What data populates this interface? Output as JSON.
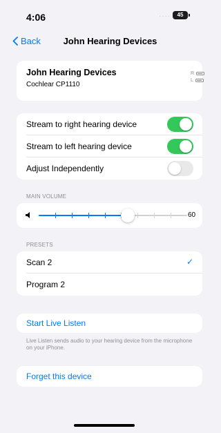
{
  "status_bar": {
    "time": "4:06",
    "signal": "····",
    "battery": "45"
  },
  "nav": {
    "back_label": "Back",
    "title": "John Hearing Devices"
  },
  "device": {
    "name": "John Hearing Devices",
    "model": "Cochlear CP1110",
    "right_label": "R",
    "left_label": "L"
  },
  "toggles": [
    {
      "label": "Stream to right hearing device",
      "on": true
    },
    {
      "label": "Stream to left hearing device",
      "on": true
    },
    {
      "label": "Adjust Independently",
      "on": false
    }
  ],
  "volume": {
    "header": "MAIN VOLUME",
    "value": "60",
    "fraction": 0.6
  },
  "presets": {
    "header": "PRESETS",
    "items": [
      {
        "label": "Scan 2",
        "selected": true,
        "check": "✓"
      },
      {
        "label": "Program 2",
        "selected": false
      }
    ]
  },
  "live_listen": {
    "label": "Start Live Listen",
    "description": "Live Listen sends audio to your hearing device from the microphone on your iPhone."
  },
  "forget": {
    "label": "Forget this device"
  },
  "colors": {
    "accent": "#007aff",
    "toggle_on": "#34c759",
    "background": "#f2f2f7"
  }
}
